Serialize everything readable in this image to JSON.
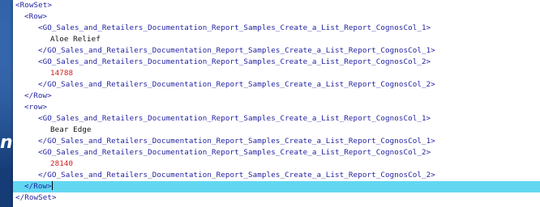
{
  "side_glyph": "n",
  "xml_lines": [
    "<RowSet>",
    "<Row>",
    "<GO_Sales_and_Retailers_Documentation_Report_Samples_Create_a_List_Report_CognosCol_1>",
    "Aloe Relief",
    "</GO_Sales_and_Retailers_Documentation_Report_Samples_Create_a_List_Report_CognosCol_1>",
    "<GO_Sales_and_Retailers_Documentation_Report_Samples_Create_a_List_Report_CognosCol_2>",
    "14788",
    "</GO_Sales_and_Retailers_Documentation_Report_Samples_Create_a_List_Report_CognosCol_2>",
    "</Row>",
    "<row>",
    "<GO_Sales_and_Retailers_Documentation_Report_Samples_Create_a_List_Report_CognosCol_1>",
    "Bear Edge",
    "</GO_Sales_and_Retailers_Documentation_Report_Samples_Create_a_List_Report_CognosCol_1>",
    "<GO_Sales_and_Retailers_Documentation_Report_Samples_Create_a_List_Report_CognosCol_2>",
    "28140",
    "</GO_Sales_and_Retailers_Documentation_Report_Samples_Create_a_List_Report_CognosCol_2>",
    "</Row>",
    "</RowSet>"
  ],
  "colors": {
    "tag": "#1f1f9f",
    "text": "#111111",
    "number": "#d21b1b",
    "highlight": "#63d7f1",
    "background": "#1d4b8c"
  }
}
